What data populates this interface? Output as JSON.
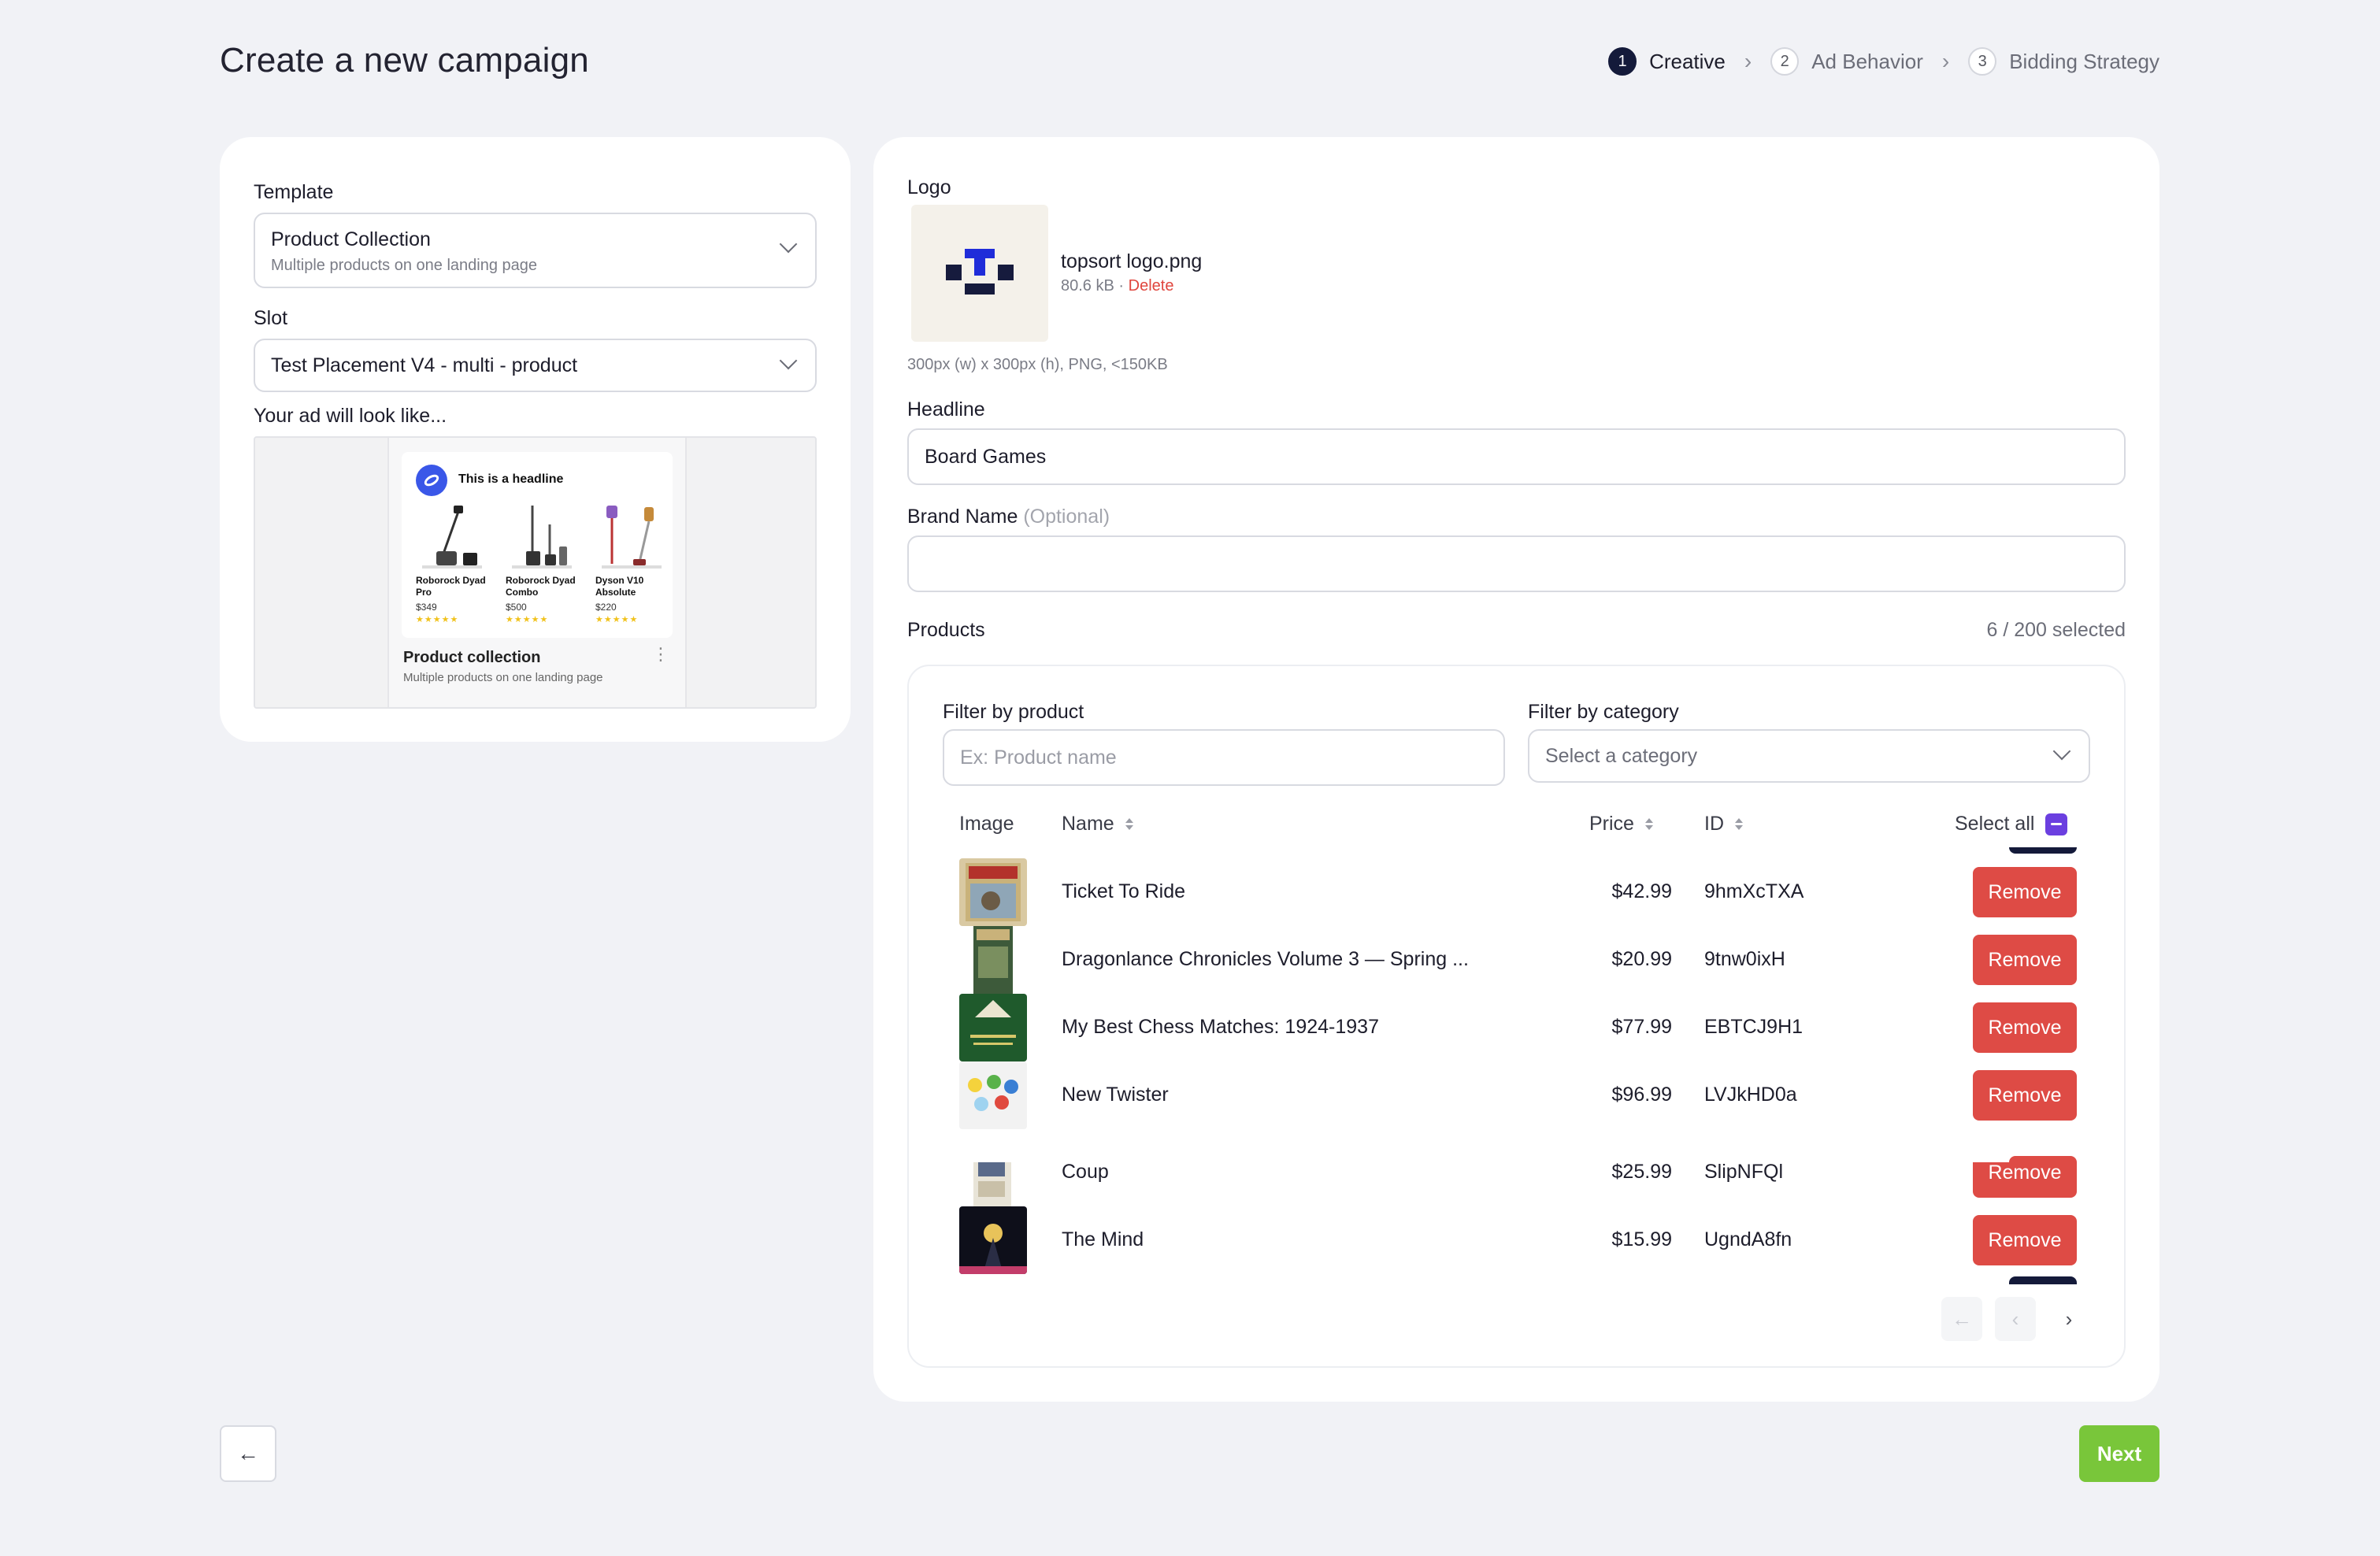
{
  "page": {
    "title": "Create a new campaign"
  },
  "stepper": {
    "steps": [
      {
        "num": "1",
        "label": "Creative",
        "active": true
      },
      {
        "num": "2",
        "label": "Ad Behavior",
        "active": false
      },
      {
        "num": "3",
        "label": "Bidding Strategy",
        "active": false
      }
    ]
  },
  "left": {
    "template_label": "Template",
    "template_value": "Product Collection",
    "template_sub": "Multiple products on one landing page",
    "slot_label": "Slot",
    "slot_value": "Test Placement V4 - multi - product",
    "preview_label": "Your ad will look like...",
    "preview": {
      "headline": "This is a headline",
      "items": [
        {
          "name": "Roborock Dyad Pro",
          "price": "$349",
          "stars": "★★★★★"
        },
        {
          "name": "Roborock Dyad Combo",
          "price": "$500",
          "stars": "★★★★★"
        },
        {
          "name": "Dyson V10 Absolute",
          "price": "$220",
          "stars": "★★★★★"
        }
      ],
      "title": "Product collection",
      "subtitle": "Multiple products on one landing page"
    }
  },
  "right": {
    "logo_label": "Logo",
    "logo_file": {
      "name": "topsort logo.png",
      "size": "80.6 kB",
      "separator": "·",
      "delete_label": "Delete",
      "hint": "300px (w) x 300px (h), PNG, <150KB"
    },
    "headline_label": "Headline",
    "headline_value": "Board Games",
    "brand_label": "Brand Name",
    "brand_optional": "(Optional)",
    "brand_value": "",
    "products_label": "Products",
    "products_count": "6 / 200 selected",
    "filter_product_label": "Filter by product",
    "filter_product_placeholder": "Ex: Product name",
    "filter_category_label": "Filter by category",
    "filter_category_placeholder": "Select a category",
    "table": {
      "headers": {
        "image": "Image",
        "name": "Name",
        "price": "Price",
        "id": "ID",
        "select_all": "Select all"
      },
      "rows": [
        {
          "name": "Ticket To Ride",
          "price": "$42.99",
          "id": "9hmXcTXA",
          "action": "Remove"
        },
        {
          "name": "Dragonlance Chronicles Volume 3 — Spring ...",
          "price": "$20.99",
          "id": "9tnw0ixH",
          "action": "Remove"
        },
        {
          "name": "My Best Chess Matches: 1924-1937",
          "price": "$77.99",
          "id": "EBTCJ9H1",
          "action": "Remove"
        },
        {
          "name": "New Twister",
          "price": "$96.99",
          "id": "LVJkHD0a",
          "action": "Remove"
        },
        {
          "name": "Coup",
          "price": "$25.99",
          "id": "SlipNFQl",
          "action": "Remove"
        },
        {
          "name": "The Mind",
          "price": "$15.99",
          "id": "UgndA8fn",
          "action": "Remove"
        }
      ]
    }
  },
  "footer": {
    "next_label": "Next"
  },
  "colors": {
    "accent": "#6b3fe0",
    "remove": "#de4b45",
    "next": "#79c63a",
    "step_active": "#141a3a"
  }
}
